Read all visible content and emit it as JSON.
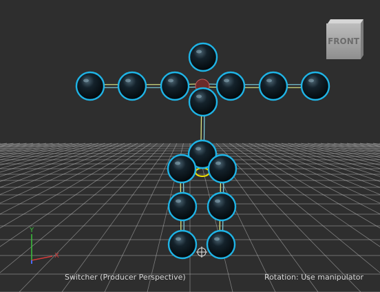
{
  "viewport": {
    "camera_label": "Switcher (Producer Perspective)",
    "status_message": "Rotation: Use manipulator",
    "view_cube_label": "FRONT"
  },
  "axes": {
    "y_label": "Y",
    "x_label": "X",
    "colors": {
      "x": "#d43b3b",
      "y": "#3bc23b",
      "z": "#4a6cff"
    }
  },
  "colors": {
    "background": "#2e2e2e",
    "grid": "#cfcfcf",
    "joint_outline": "#1fb4e6",
    "bone": "#e6f28a",
    "hips_marker": "#f2e200"
  },
  "skeleton": {
    "joints": [
      "head",
      "neck",
      "chest",
      "left-shoulder",
      "left-elbow",
      "left-wrist",
      "left-hand",
      "right-shoulder",
      "right-elbow",
      "right-wrist",
      "right-hand",
      "hips",
      "left-hip",
      "right-hip",
      "left-knee",
      "right-knee",
      "left-ankle",
      "right-ankle"
    ]
  }
}
